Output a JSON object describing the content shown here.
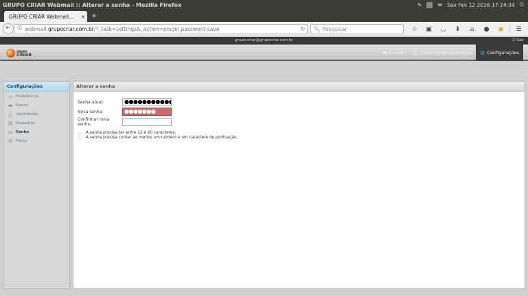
{
  "os": {
    "window_title": "GRUPO CRIAR Webmail :: Alterar a senha - Mozilla Firefox",
    "clock": "Sex Fev 12 2016 17:24:34",
    "tray_icons": [
      "pen-icon",
      "keyboard-icon",
      "mail-indicator-icon",
      "power-icon"
    ]
  },
  "browser": {
    "tab_title": "GRUPO CRIAR Webmail...",
    "tab_close": "×",
    "new_tab": "+",
    "url_prefix": "webmail.",
    "url_domain": "grupocriar.com.br",
    "url_suffix": "/?_task=settings&_action=plugin.password-save",
    "search_placeholder": "Pesquisar",
    "toolbar_icons": [
      "star-icon",
      "clipboard-icon",
      "pocket-icon",
      "download-icon",
      "home-icon",
      "chat-icon",
      "chrome-icon",
      "menu-icon"
    ]
  },
  "webmail": {
    "user_email": "grupo.criar@grupocriar.com.br",
    "logout_label": "Sair",
    "logo_line1": "GRUPO",
    "logo_line2": "CRIAR",
    "nav": {
      "email": "E-mail",
      "addressbook": "Catálogo de endereços",
      "settings": "Configurações"
    }
  },
  "sidebar": {
    "title": "Configurações",
    "items": [
      {
        "label": "Preferências",
        "icon": "preferences-icon",
        "active": false
      },
      {
        "label": "Pastas",
        "icon": "folder-icon",
        "active": false
      },
      {
        "label": "Identidades",
        "icon": "identity-icon",
        "active": false
      },
      {
        "label": "Respostas",
        "icon": "responses-icon",
        "active": false
      },
      {
        "label": "Senha",
        "icon": "password-icon",
        "active": true
      },
      {
        "label": "Filtros",
        "icon": "filters-icon",
        "active": false
      }
    ]
  },
  "main": {
    "title": "Alterar a senha",
    "fields": {
      "current_label": "Senha atual:",
      "current_value": "●●●●●●●●●●●●●●●",
      "new_label": "Nova senha:",
      "new_value": "●●●●●●●",
      "confirm_label": "Confirmar nova senha:",
      "confirm_value": ""
    },
    "rules": [
      "A senha precisa ter entre 12 e 20 caracteres.",
      "A senha precisa conter ao menos um número e um caractere de pontuação."
    ]
  }
}
